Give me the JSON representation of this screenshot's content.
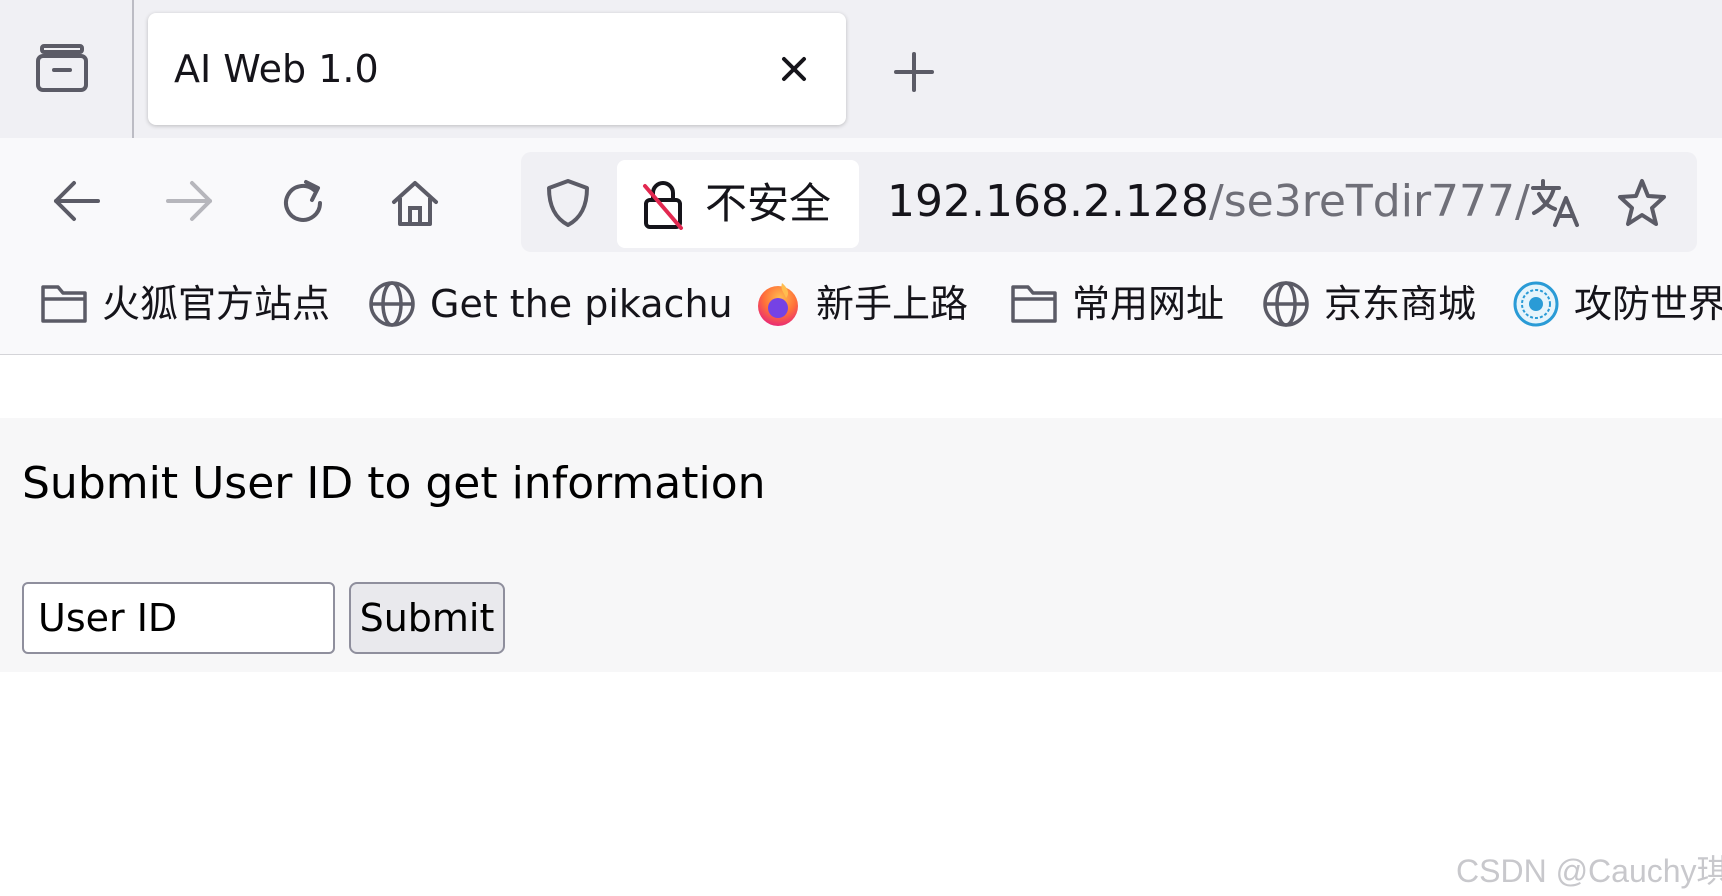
{
  "browser": {
    "tab": {
      "title": "AI Web 1.0"
    },
    "urlbar": {
      "security_label": "不安全",
      "host": "192.168.2.128",
      "path": "/se3reTdir777/"
    },
    "bookmarks": [
      {
        "label": "火狐官方站点",
        "icon": "folder-icon"
      },
      {
        "label": "Get the pikachu",
        "icon": "globe-icon"
      },
      {
        "label": "新手上路",
        "icon": "firefox-icon"
      },
      {
        "label": "常用网址",
        "icon": "folder-icon"
      },
      {
        "label": "京东商城",
        "icon": "globe-icon"
      },
      {
        "label": "攻防世界",
        "icon": "site-logo-icon"
      }
    ]
  },
  "page": {
    "heading": "Submit User ID to get information",
    "form": {
      "input_placeholder": "User ID",
      "submit_label": "Submit"
    }
  },
  "watermark": "CSDN @Cauchy琪"
}
